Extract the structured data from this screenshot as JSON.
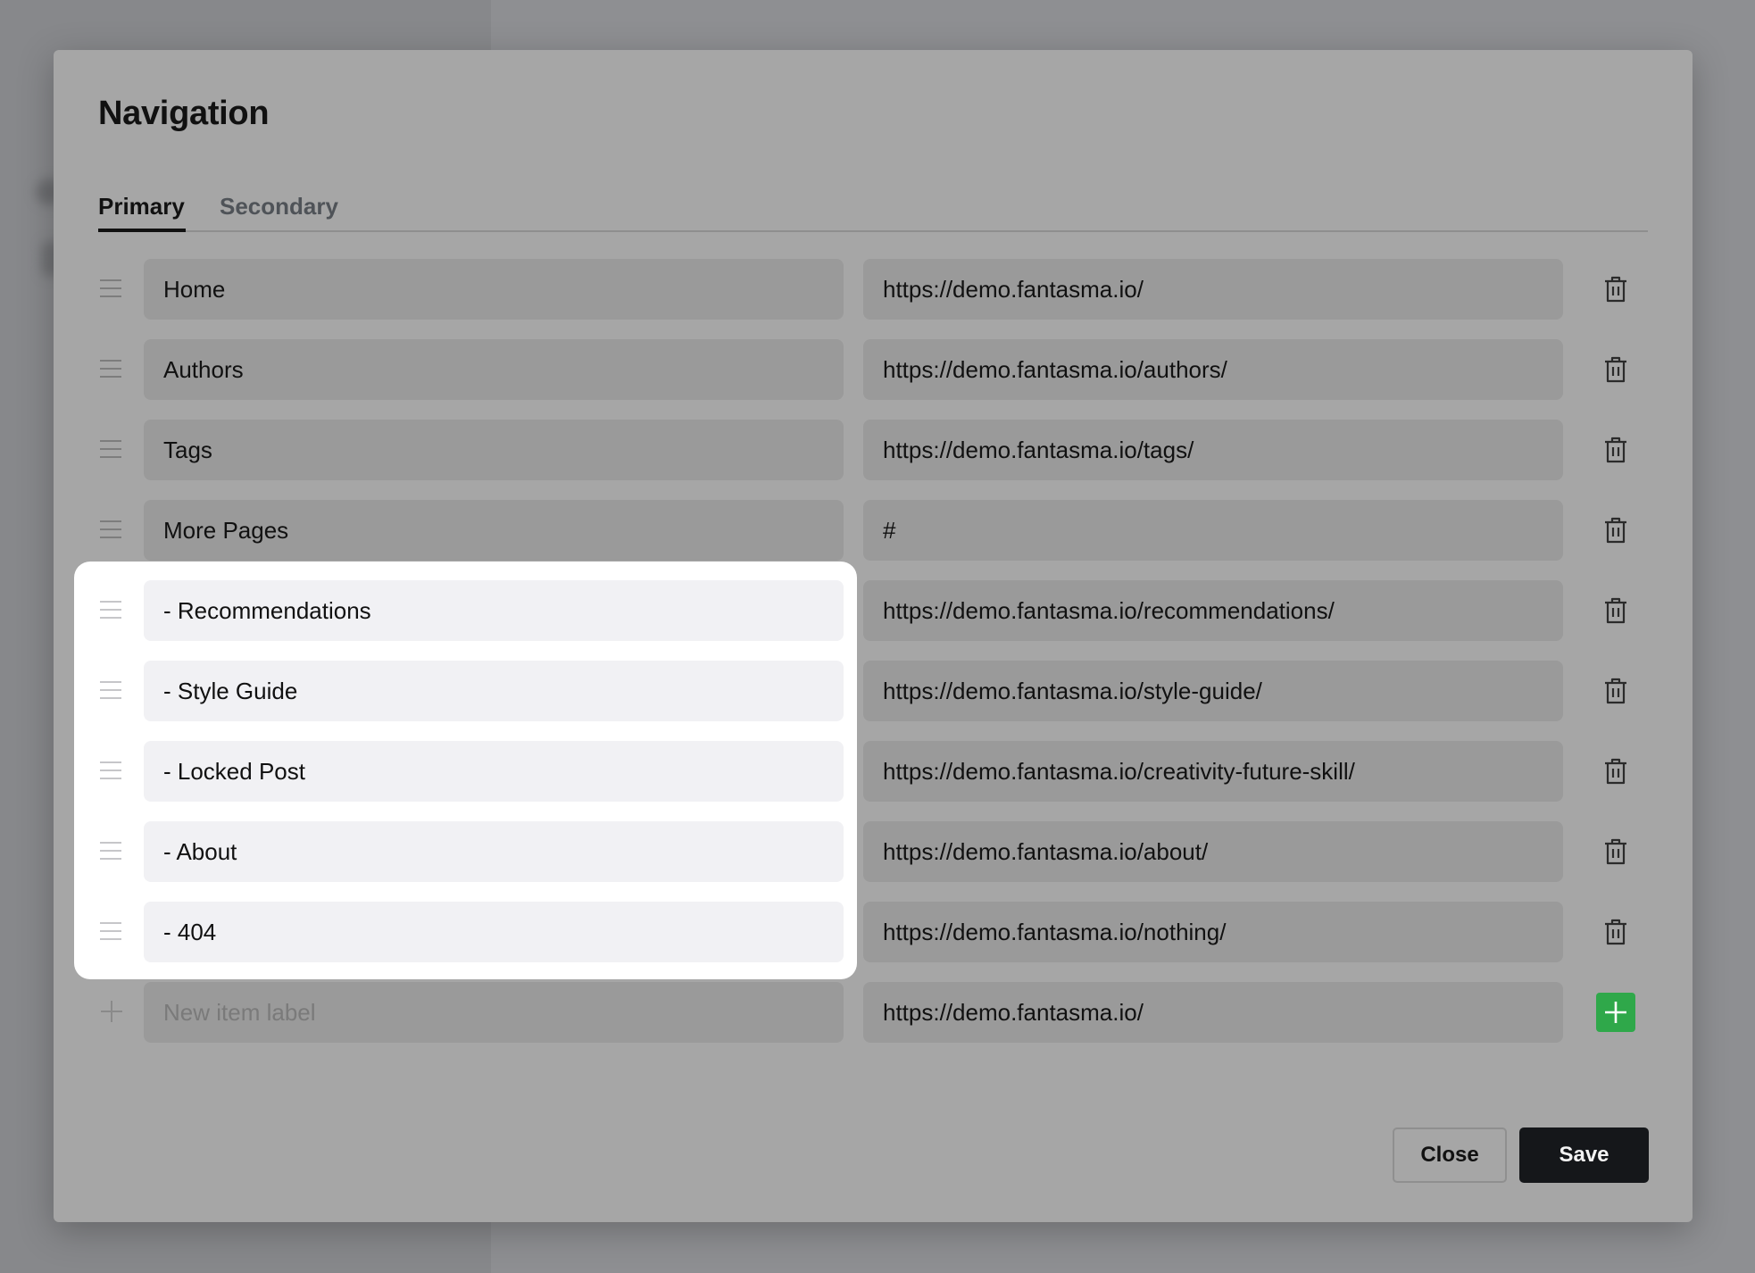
{
  "modal": {
    "title": "Navigation",
    "tabs": [
      "Primary",
      "Secondary"
    ],
    "active_tab": "Primary"
  },
  "items": [
    {
      "label": "Home",
      "url": "https://demo.fantasma.io/"
    },
    {
      "label": "Authors",
      "url": "https://demo.fantasma.io/authors/"
    },
    {
      "label": "Tags",
      "url": "https://demo.fantasma.io/tags/"
    },
    {
      "label": "More Pages",
      "url": "#"
    },
    {
      "label": "- Recommendations",
      "url": "https://demo.fantasma.io/recommendations/"
    },
    {
      "label": "- Style Guide",
      "url": "https://demo.fantasma.io/style-guide/"
    },
    {
      "label": "- Locked Post",
      "url": "https://demo.fantasma.io/creativity-future-skill/"
    },
    {
      "label": "- About",
      "url": "https://demo.fantasma.io/about/"
    },
    {
      "label": "- 404",
      "url": "https://demo.fantasma.io/nothing/"
    }
  ],
  "new_item": {
    "label_placeholder": "New item label",
    "url_value": "https://demo.fantasma.io/"
  },
  "footer": {
    "close_label": "Close",
    "save_label": "Save"
  },
  "icons": {
    "drag": "drag-handle-icon",
    "delete": "trash-icon",
    "add": "plus-icon"
  },
  "colors": {
    "add_button": "#2fa84a",
    "save_button": "#15171a",
    "highlight": "#ffffff"
  }
}
